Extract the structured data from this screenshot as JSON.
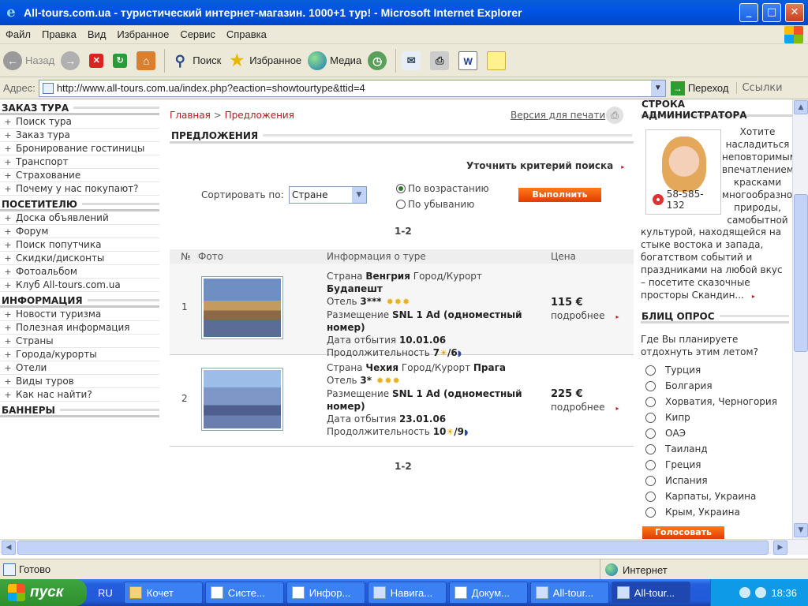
{
  "window": {
    "title": "All-tours.com.ua - туристический интернет-магазин. 1000+1 тур! - Microsoft Internet Explorer",
    "min": "_",
    "max": "□",
    "close": "✕"
  },
  "menu": [
    "Файл",
    "Правка",
    "Вид",
    "Избранное",
    "Сервис",
    "Справка"
  ],
  "toolbar": {
    "back": "Назад",
    "search": "Поиск",
    "favorites": "Избранное",
    "media": "Медиа"
  },
  "address": {
    "label": "Адрес:",
    "url": "http://www.all-tours.com.ua/index.php?eaction=showtourtype&ttid=4",
    "go": "Переход",
    "links": "Ссылки"
  },
  "left": {
    "sections": [
      {
        "title": "ЗАКАЗ ТУРА",
        "items": [
          "Поиск тура",
          "Заказ тура",
          "Бронирование гостиницы",
          "Транспорт",
          "Страхование",
          "Почему у нас покупают?"
        ]
      },
      {
        "title": "ПОСЕТИТЕЛЮ",
        "items": [
          "Доска объявлений",
          "Форум",
          "Поиск попутчика",
          "Скидки/дисконты",
          "Фотоальбом",
          "Клуб All-tours.com.ua"
        ]
      },
      {
        "title": "ИНФОРМАЦИЯ",
        "items": [
          "Новости туризма",
          "Полезная информация",
          "Страны",
          "Города/курорты",
          "Отели",
          "Виды туров",
          "Как нас найти?"
        ]
      },
      {
        "title": "БАННЕРЫ",
        "items": []
      }
    ]
  },
  "center": {
    "breadcrumb": {
      "home": "Главная",
      "sep": ">",
      "current": "Предложения"
    },
    "print": "Версия для печати",
    "heading": "ПРЕДЛОЖЕНИЯ",
    "refine": "Уточнить критерий поиска",
    "sort_label": "Сортировать по:",
    "sort_value": "Стране",
    "asc": "По возрастанию",
    "desc": "По убыванию",
    "run": "Выполнить",
    "pager": "1-2",
    "table": {
      "no": "№",
      "photo": "Фото",
      "info": "Информация о туре",
      "price": "Цена"
    },
    "tours": [
      {
        "num": "1",
        "country_label": "Страна",
        "country": "Венгрия",
        "city_label": "Город/Курорт",
        "city": "Будапешт",
        "hotel_label": "Отель",
        "hotel": "3***",
        "accom_label": "Размещение",
        "accom": "SNL 1 Ad (одноместный номер)",
        "date_label": "Дата отбытия",
        "date": "10.01.06",
        "dur_label": "Продолжительность",
        "days": "7",
        "nights": "/6",
        "price": "115 €",
        "more": "подробнее"
      },
      {
        "num": "2",
        "country_label": "Страна",
        "country": "Чехия",
        "city_label": "Город/Курорт",
        "city": "Прага",
        "hotel_label": "Отель",
        "hotel": "3*",
        "accom_label": "Размещение",
        "accom": "SNL 1 Ad (одноместный номер)",
        "date_label": "Дата отбытия",
        "date": "23.01.06",
        "dur_label": "Продолжительность",
        "days": "10",
        "nights": "/9",
        "price": "225 €",
        "more": "подробнее"
      }
    ]
  },
  "right": {
    "admin_title": "СТРОКА АДМИНИСТРАТОРА",
    "phone": "58-585-132",
    "admin_text1": "Хотите насладиться неповторимым впечатлением красками многообразной природы, самобытной",
    "admin_text2": "культурой, находящейся на стыке востока и запада, богатством событий и праздниками на любой вкус – посетите  сказочные просторы Скандин...",
    "poll_title": "БЛИЦ ОПРОС",
    "poll_q": "Где Вы планируете отдохнуть этим летом?",
    "options": [
      "Турция",
      "Болгария",
      "Хорватия, Черногория",
      "Кипр",
      "ОАЭ",
      "Таиланд",
      "Греция",
      "Испания",
      "Карпаты, Украина",
      "Крым, Украина"
    ],
    "vote": "Голосовать"
  },
  "status": {
    "text": "Готово",
    "zone": "Интернет"
  },
  "taskbar": {
    "start": "пуск",
    "lang": "RU",
    "tasks": [
      "Кочет",
      "Систе...",
      "Инфор...",
      "Навига...",
      "Докум...",
      "All-tour...",
      "All-tour..."
    ],
    "clock": "18:36"
  }
}
